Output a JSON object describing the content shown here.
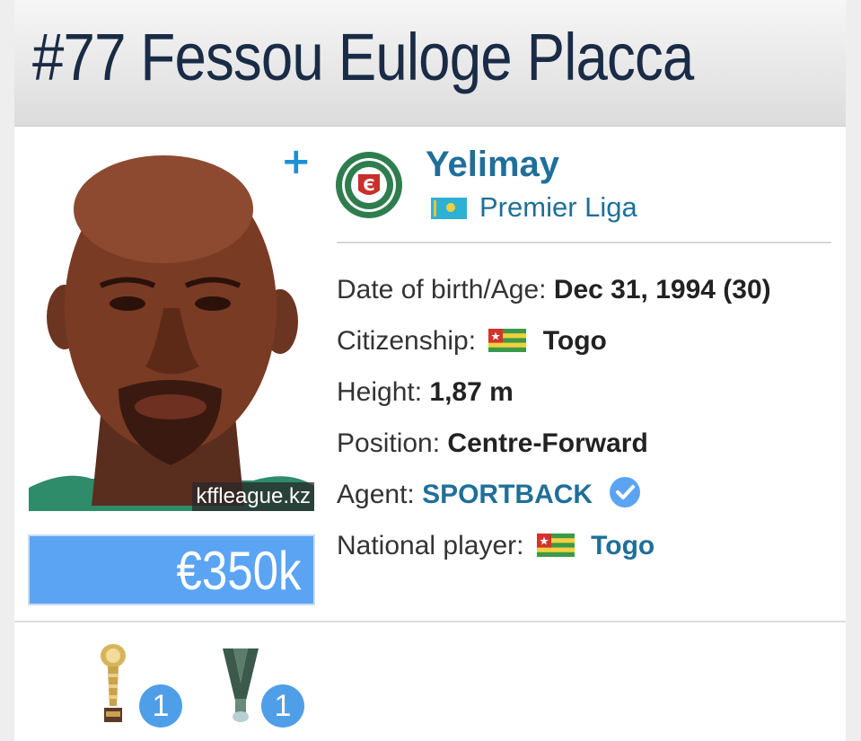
{
  "header": {
    "number": "#77",
    "first_names": "Fessou Euloge",
    "last_name": "Placca"
  },
  "photo": {
    "watermark": "kffleague.kz"
  },
  "market_value": "€350k",
  "club": {
    "name": "Yelimay",
    "league": "Premier Liga",
    "league_flag": "kazakhstan-flag-icon"
  },
  "details": {
    "dob_label": "Date of birth/Age:",
    "dob_value": "Dec 31, 1994 (30)",
    "citizenship_label": "Citizenship:",
    "citizenship_value": "Togo",
    "height_label": "Height:",
    "height_value": "1,87 m",
    "position_label": "Position:",
    "position_value": "Centre-Forward",
    "agent_label": "Agent:",
    "agent_value": "SPORTBACK",
    "national_label": "National player:",
    "national_value": "Togo"
  },
  "achievements": [
    {
      "icon": "golden-trophy-icon",
      "count": "1"
    },
    {
      "icon": "medal-ribbon-icon",
      "count": "1"
    }
  ],
  "colors": {
    "accent": "#1f6f9a",
    "value_bg": "#5ba4f4",
    "badge": "#4f9ee8",
    "title": "#1a2b46"
  }
}
